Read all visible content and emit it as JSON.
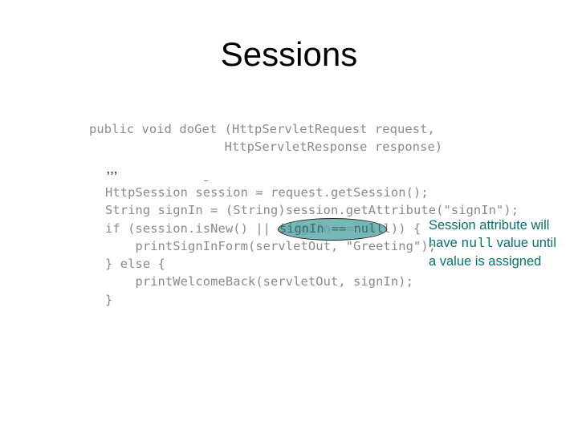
{
  "slide": {
    "title": "Sessions",
    "code_signature": [
      "public void doGet (HttpServletRequest request,",
      "                  HttpServletResponse response)"
    ],
    "ellipsis": ",,,",
    "code_body": [
      "HttpSession session = request.getSession();",
      "String signIn = (String)session.getAttribute(\"signIn\");",
      "if (session.isNew() || (signIn == null)) {",
      "    printSignInForm(servletOut, \"Greeting\");",
      "} else {",
      "    printWelcomeBack(servletOut, signIn);",
      "}"
    ],
    "highlight": {
      "text": "signIn == null",
      "color": "#60aaaa"
    },
    "annotation": {
      "line1": "Session attribute will",
      "line2_prefix": "have ",
      "line2_code": "null",
      "line2_suffix": " value until",
      "line3": "a value is assigned",
      "color": "#0a6e6e"
    }
  }
}
